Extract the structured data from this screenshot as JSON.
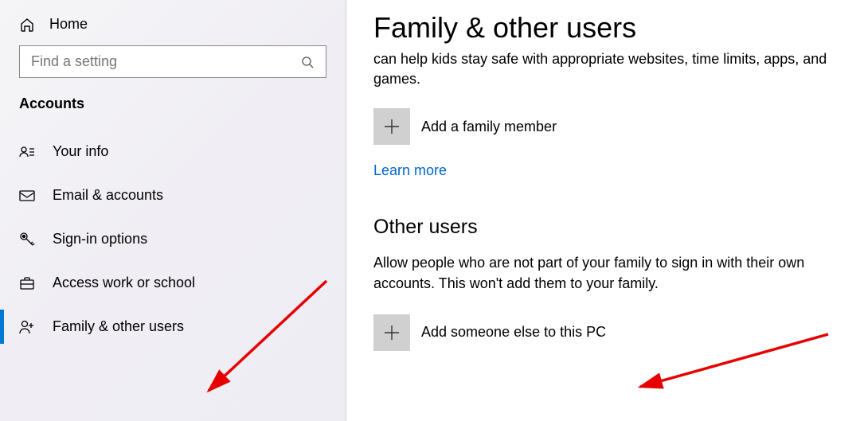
{
  "sidebar": {
    "home": "Home",
    "search_placeholder": "Find a setting",
    "section": "Accounts",
    "items": [
      {
        "label": "Your info"
      },
      {
        "label": "Email & accounts"
      },
      {
        "label": "Sign-in options"
      },
      {
        "label": "Access work or school"
      },
      {
        "label": "Family & other users"
      }
    ]
  },
  "main": {
    "title": "Family & other users",
    "description": "can help kids stay safe with appropriate websites, time limits, apps, and games.",
    "add_family_label": "Add a family member",
    "learn_more": "Learn more",
    "other_users_heading": "Other users",
    "other_users_desc": "Allow people who are not part of your family to sign in with their own accounts. This won't add them to your family.",
    "add_other_label": "Add someone else to this PC"
  }
}
